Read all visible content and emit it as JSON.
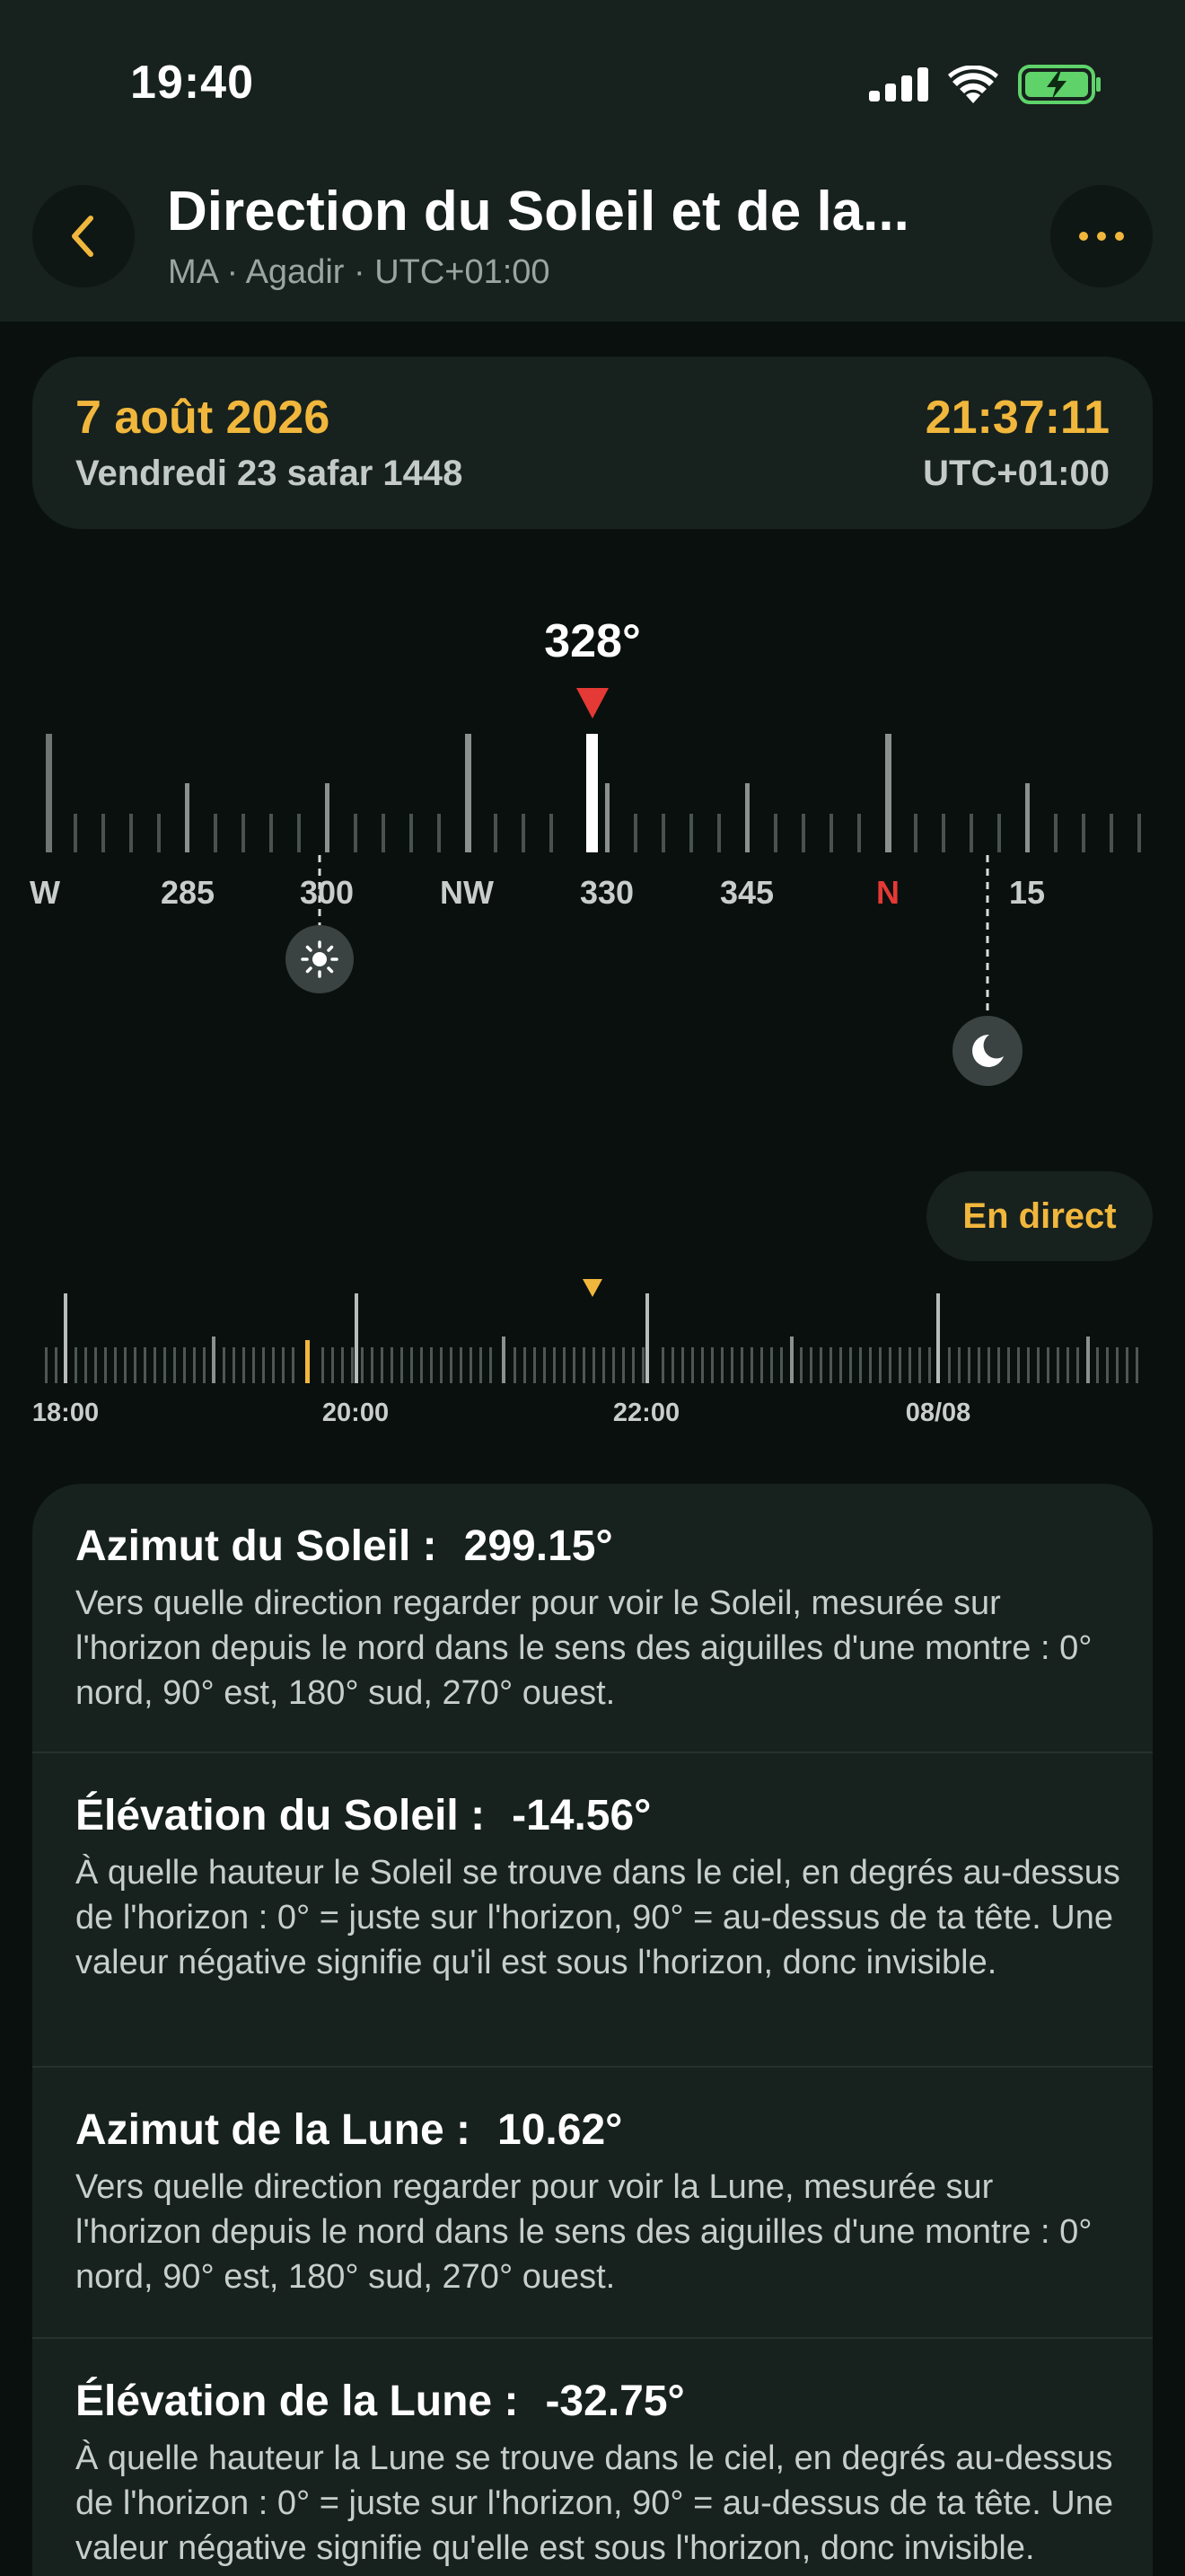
{
  "status_bar": {
    "time": "19:40",
    "icons": [
      "signal-icon",
      "wifi-icon",
      "battery-charging-icon"
    ]
  },
  "header": {
    "title": "Direction du Soleil et de la...",
    "subtitle": "MA · Agadir · UTC+01:00",
    "back_icon": "chevron-left-icon",
    "more_icon": "ellipsis-icon"
  },
  "date_card": {
    "date": "7 août 2026",
    "hijri_date": "Vendredi 23 safar 1448",
    "time": "21:37:11",
    "timezone": "UTC+01:00"
  },
  "compass": {
    "heading": "328°",
    "labels": [
      "W",
      "285",
      "300",
      "NW",
      "330",
      "345",
      "N",
      "15"
    ],
    "sun_icon": "sun-icon",
    "moon_icon": "moon-icon",
    "colors": {
      "accent": "#f1b73c",
      "north": "#e53935",
      "marker": "#e53935"
    }
  },
  "live_button": {
    "label": "En direct"
  },
  "timeline": {
    "labels": [
      "18:00",
      "20:00",
      "22:00",
      "08/08"
    ]
  },
  "info": {
    "items": [
      {
        "label": "Azimut du Soleil :",
        "value": "299.15°",
        "description": "Vers quelle direction regarder pour voir le Soleil, mesurée sur l'horizon depuis le nord dans le sens des aiguilles d'une montre : 0° nord, 90° est, 180° sud, 270° ouest."
      },
      {
        "label": "Élévation du Soleil :",
        "value": "-14.56°",
        "description": "À quelle hauteur le Soleil se trouve dans le ciel, en degrés au-dessus de l'horizon : 0° = juste sur l'horizon, 90° = au-dessus de ta tête. Une valeur négative signifie qu'il est sous l'horizon, donc invisible."
      },
      {
        "label": "Azimut de la Lune :",
        "value": "10.62°",
        "description": "Vers quelle direction regarder pour voir la Lune, mesurée sur l'horizon depuis le nord dans le sens des aiguilles d'une montre : 0° nord, 90° est, 180° sud, 270° ouest."
      },
      {
        "label": "Élévation de la Lune :",
        "value": "-32.75°",
        "description": "À quelle hauteur la Lune se trouve dans le ciel, en degrés au-dessus de l'horizon : 0° = juste sur l'horizon, 90° = au-dessus de ta tête. Une valeur négative signifie qu'elle est sous l'horizon, donc invisible."
      }
    ]
  }
}
